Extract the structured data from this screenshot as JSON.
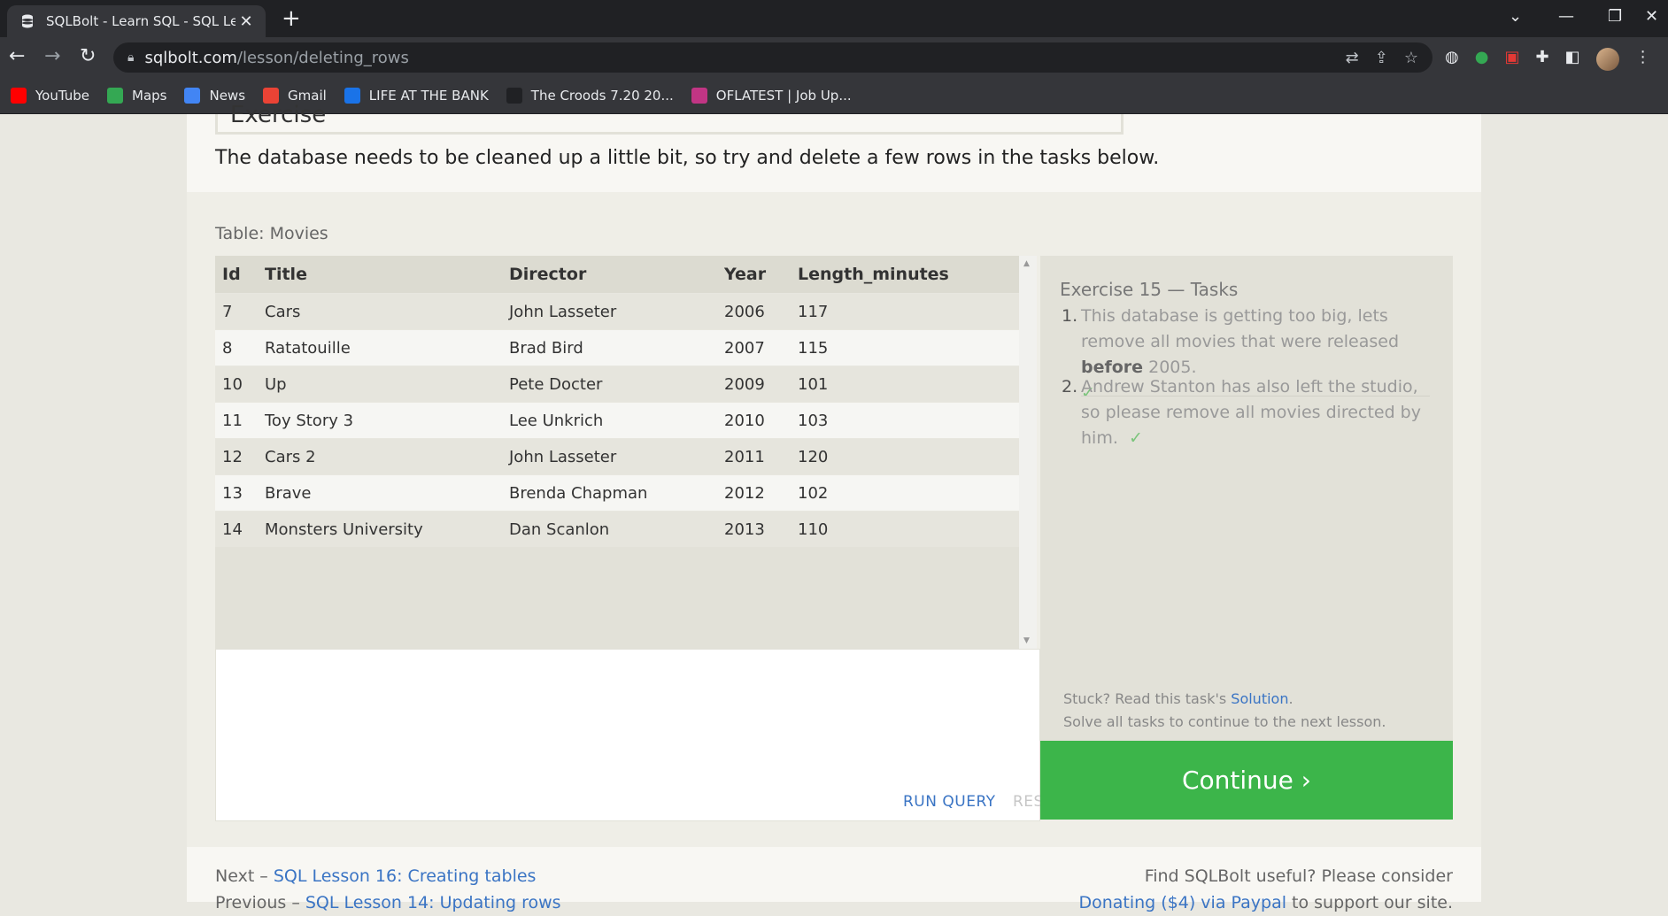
{
  "browser": {
    "tab_title": "SQLBolt - Learn SQL - SQL Lesso",
    "url_host": "sqlbolt.com",
    "url_path": "/lesson/deleting_rows",
    "bookmarks": [
      {
        "label": "YouTube",
        "color": "#ff0000",
        "icon": "youtube-icon"
      },
      {
        "label": "Maps",
        "color": "#34a853",
        "icon": "maps-icon"
      },
      {
        "label": "News",
        "color": "#4285f4",
        "icon": "news-icon"
      },
      {
        "label": "Gmail",
        "color": "#ea4335",
        "icon": "gmail-icon"
      },
      {
        "label": "LIFE AT THE BANK",
        "color": "#1a73e8",
        "icon": "bank-icon"
      },
      {
        "label": "The Croods 7.20 20...",
        "color": "#202124",
        "icon": "play-icon"
      },
      {
        "label": "OFLATEST | Job Up...",
        "color": "#c13584",
        "icon": "instagram-icon"
      }
    ]
  },
  "lesson": {
    "exercise_heading": "Exercise",
    "intro": "The database needs to be cleaned up a little bit, so try and delete a few rows in the tasks below.",
    "table_label": "Table: Movies",
    "columns": [
      "Id",
      "Title",
      "Director",
      "Year",
      "Length_minutes"
    ],
    "rows": [
      [
        "7",
        "Cars",
        "John Lasseter",
        "2006",
        "117"
      ],
      [
        "8",
        "Ratatouille",
        "Brad Bird",
        "2007",
        "115"
      ],
      [
        "10",
        "Up",
        "Pete Docter",
        "2009",
        "101"
      ],
      [
        "11",
        "Toy Story 3",
        "Lee Unkrich",
        "2010",
        "103"
      ],
      [
        "12",
        "Cars 2",
        "John Lasseter",
        "2011",
        "120"
      ],
      [
        "13",
        "Brave",
        "Brenda Chapman",
        "2012",
        "102"
      ],
      [
        "14",
        "Monsters University",
        "Dan Scanlon",
        "2013",
        "110"
      ]
    ],
    "run_query_label": "RUN QUERY",
    "reset_label": "RESET"
  },
  "tasks": {
    "title": "Exercise 15 — Tasks",
    "items": [
      {
        "num": "1.",
        "text_before": "This database is getting too big, lets remove all movies that were released ",
        "bold": "before",
        "text_after": " 2005.",
        "check": "✓"
      },
      {
        "num": "2.",
        "text_before": "Andrew Stanton has also left the studio, so please remove all movies directed by him.",
        "check": "✓"
      }
    ],
    "stuck_prefix": "Stuck? Read this task's ",
    "solution_link": "Solution",
    "stuck_suffix": ".",
    "solve_all": "Solve all tasks to continue to the next lesson.",
    "continue_label": "Continue ›"
  },
  "footer": {
    "next_prefix": "Next – ",
    "next_link": "SQL Lesson 16: Creating tables",
    "prev_prefix": "Previous – ",
    "prev_link": "SQL Lesson 14: Updating rows",
    "useful_text": "Find SQLBolt useful? Please consider",
    "donate_link": "Donating ($4) via Paypal",
    "donate_suffix": " to support our site."
  }
}
